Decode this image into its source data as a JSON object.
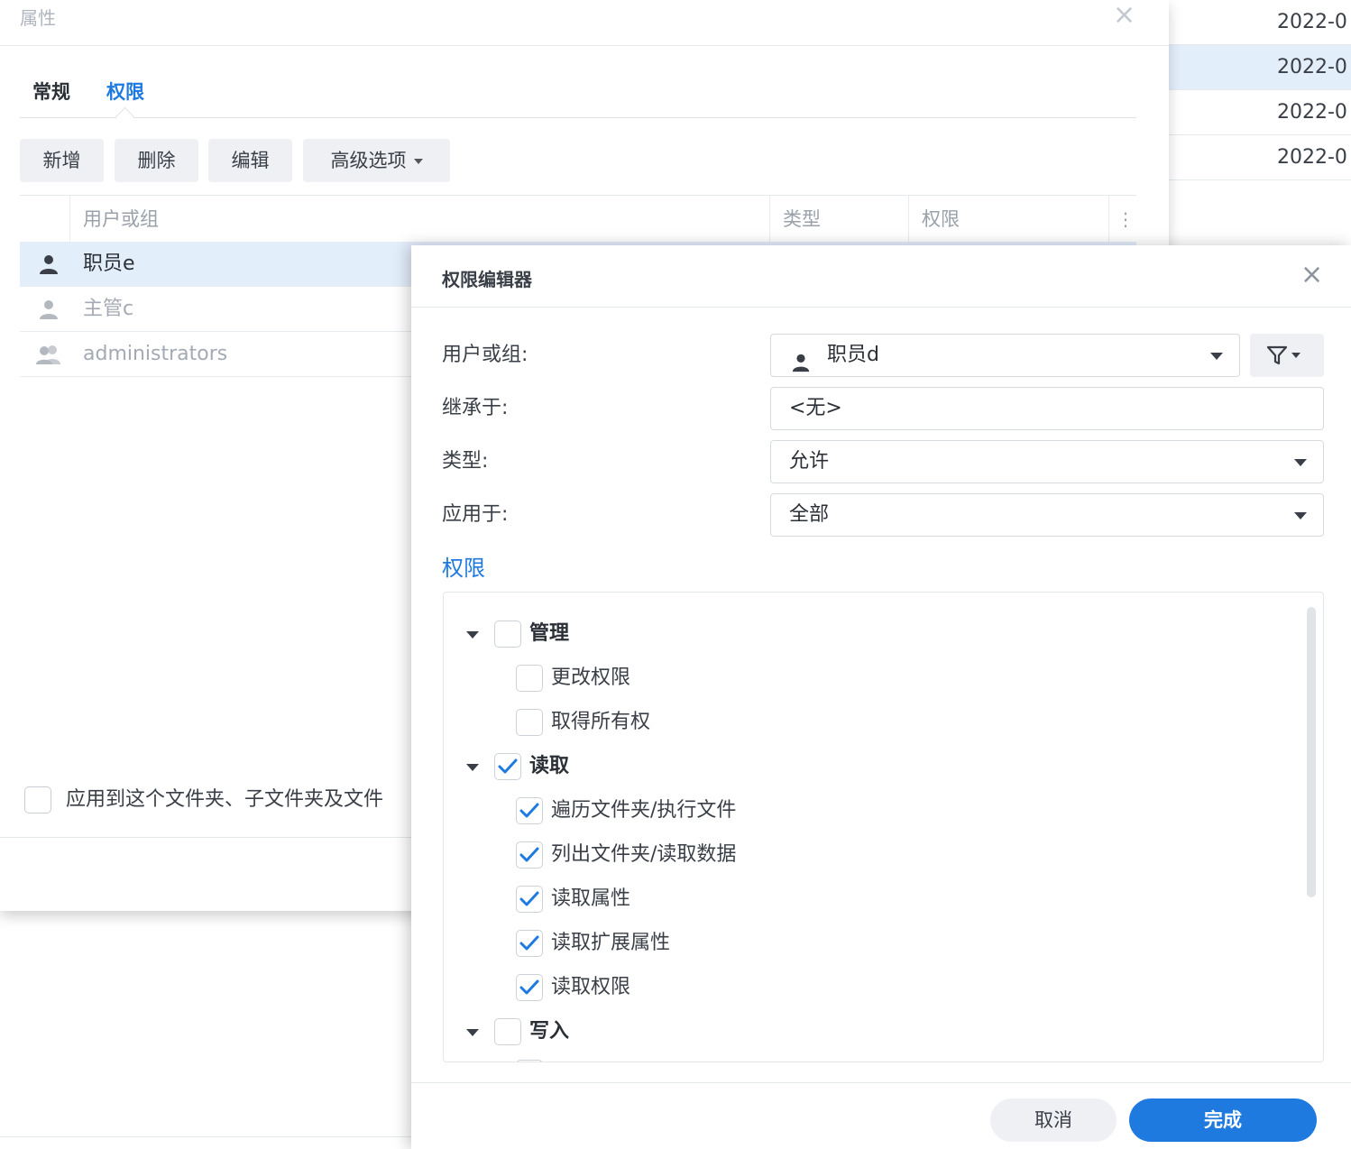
{
  "background_list": {
    "rows": [
      "2022-0",
      "2022-0",
      "2022-0",
      "2022-0"
    ]
  },
  "properties": {
    "title": "属性",
    "close": "×",
    "tabs": [
      {
        "label": "常规",
        "active": false
      },
      {
        "label": "权限",
        "active": true
      }
    ],
    "toolbar": {
      "add": "新增",
      "delete": "删除",
      "edit": "编辑",
      "advanced": "高级选项"
    },
    "table": {
      "columns": [
        "用户或组",
        "类型",
        "权限"
      ],
      "more": "⋮",
      "rows": [
        {
          "name": "职员e",
          "icon": "user-icon",
          "selected": true
        },
        {
          "name": "主管c",
          "icon": "user-icon",
          "selected": false
        },
        {
          "name": "administrators",
          "icon": "group-icon",
          "selected": false
        }
      ]
    },
    "apply_checkbox_label": "应用到这个文件夹、子文件夹及文件"
  },
  "editor": {
    "title": "权限编辑器",
    "close": "×",
    "fields": {
      "user_label": "用户或组:",
      "user_value": "职员d",
      "inherit_label": "继承于:",
      "inherit_value": "<无>",
      "type_label": "类型:",
      "type_value": "允许",
      "apply_label": "应用于:",
      "apply_value": "全部"
    },
    "section_title": "权限",
    "permissions": [
      {
        "label": "管理",
        "group": true,
        "checked": false
      },
      {
        "label": "更改权限",
        "group": false,
        "checked": false
      },
      {
        "label": "取得所有权",
        "group": false,
        "checked": false
      },
      {
        "label": "读取",
        "group": true,
        "checked": true
      },
      {
        "label": "遍历文件夹/执行文件",
        "group": false,
        "checked": true
      },
      {
        "label": "列出文件夹/读取数据",
        "group": false,
        "checked": true
      },
      {
        "label": "读取属性",
        "group": false,
        "checked": true
      },
      {
        "label": "读取扩展属性",
        "group": false,
        "checked": true
      },
      {
        "label": "读取权限",
        "group": false,
        "checked": true
      },
      {
        "label": "写入",
        "group": true,
        "checked": false
      }
    ],
    "buttons": {
      "cancel": "取消",
      "done": "完成"
    }
  },
  "colors": {
    "accent": "#1f7ae0",
    "selected_row": "#e3eefb"
  }
}
